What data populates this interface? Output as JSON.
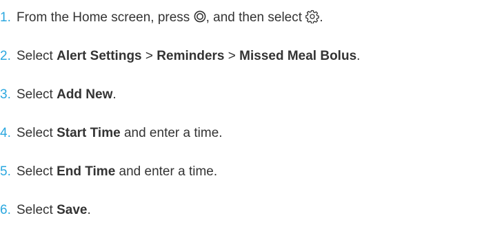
{
  "steps": [
    {
      "number": "1.",
      "parts": {
        "a": "From the Home screen, press ",
        "home_icon": "home-button-icon",
        "b": ", and then select ",
        "gear_icon": "settings-gear-icon",
        "c": "."
      }
    },
    {
      "number": "2.",
      "parts": {
        "a": "Select ",
        "b": "Alert Settings",
        "c": " > ",
        "d": "Reminders",
        "e": " > ",
        "f": "Missed Meal Bolus",
        "g": "."
      }
    },
    {
      "number": "3.",
      "parts": {
        "a": "Select ",
        "b": "Add New",
        "c": "."
      }
    },
    {
      "number": "4.",
      "parts": {
        "a": "Select ",
        "b": "Start Time",
        "c": " and enter a time."
      }
    },
    {
      "number": "5.",
      "parts": {
        "a": "Select ",
        "b": "End Time",
        "c": " and enter a time."
      }
    },
    {
      "number": "6.",
      "parts": {
        "a": "Select ",
        "b": "Save",
        "c": "."
      }
    }
  ],
  "colors": {
    "number": "#2aa7df",
    "text": "#333333"
  }
}
